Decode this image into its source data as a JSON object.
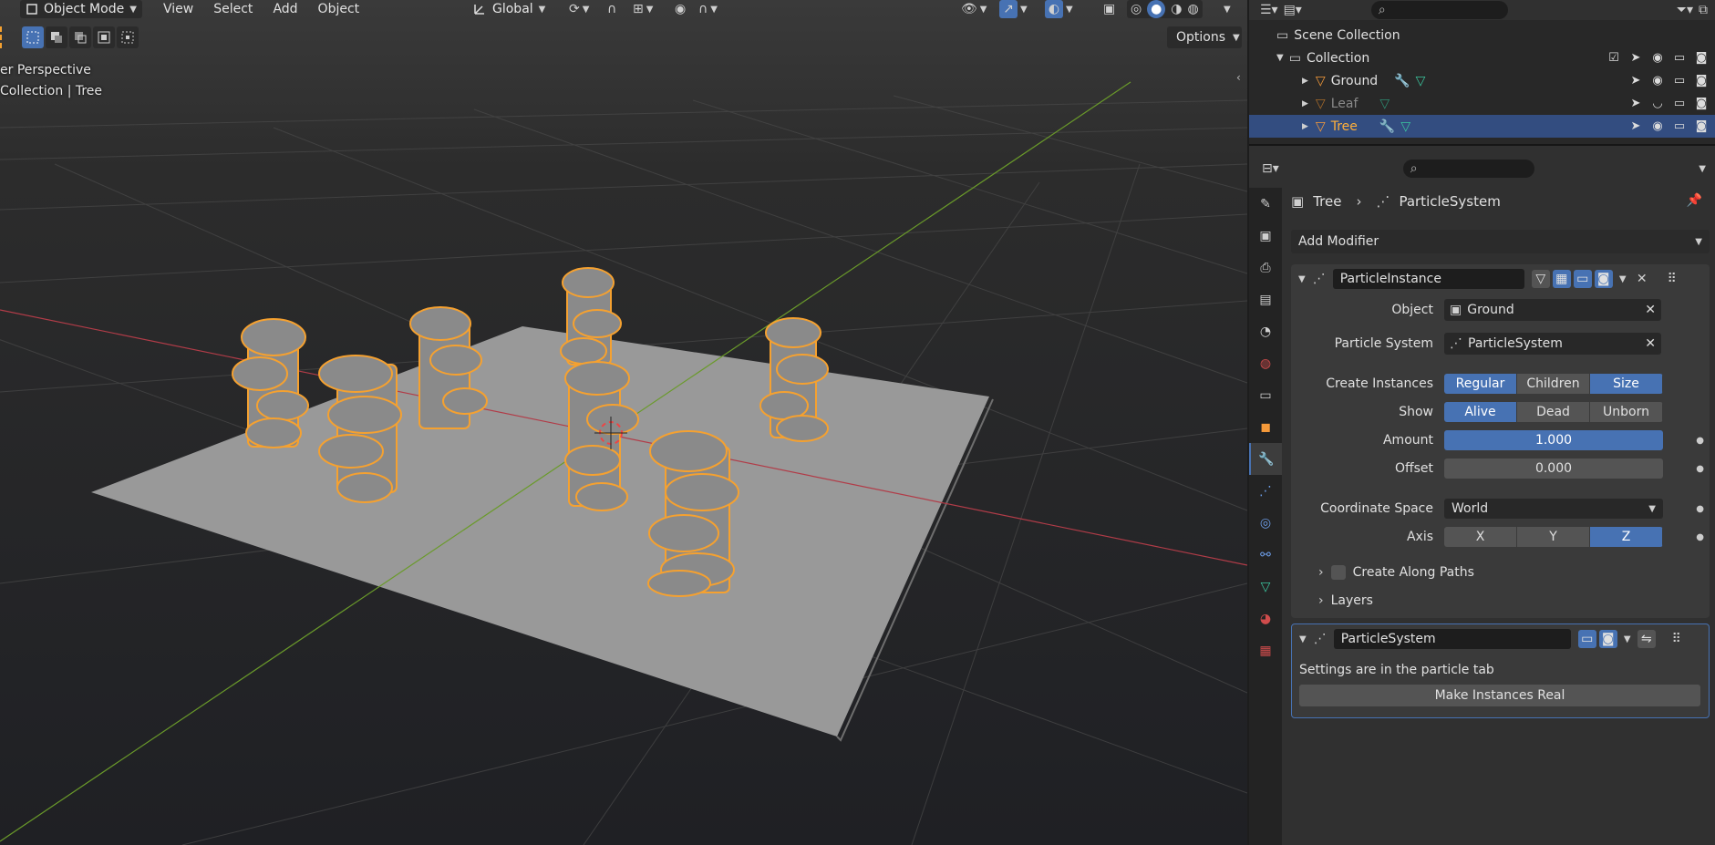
{
  "viewport": {
    "mode_label": "Object Mode",
    "menus": [
      "View",
      "Select",
      "Add",
      "Object"
    ],
    "transform_orientation": "Global",
    "options_label": "Options",
    "overlay_line1": "er Perspective",
    "overlay_line2": "Collection | Tree"
  },
  "outliner": {
    "rows": [
      {
        "label": "Scene Collection"
      },
      {
        "label": "Collection"
      },
      {
        "label": "Ground"
      },
      {
        "label": "Leaf"
      },
      {
        "label": "Tree"
      }
    ]
  },
  "properties": {
    "breadcrumb_object": "Tree",
    "breadcrumb_data": "ParticleSystem",
    "add_modifier_label": "Add Modifier",
    "particle_instance": {
      "name": "ParticleInstance",
      "object_label": "Object",
      "object_value": "Ground",
      "psys_label": "Particle System",
      "psys_value": "ParticleSystem",
      "create_label": "Create Instances",
      "create_options": [
        "Regular",
        "Children",
        "Size"
      ],
      "show_label": "Show",
      "show_options": [
        "Alive",
        "Dead",
        "Unborn"
      ],
      "amount_label": "Amount",
      "amount_value": "1.000",
      "offset_label": "Offset",
      "offset_value": "0.000",
      "coord_label": "Coordinate Space",
      "coord_value": "World",
      "axis_label": "Axis",
      "axis_options": [
        "X",
        "Y",
        "Z"
      ],
      "along_paths_label": "Create Along Paths",
      "layers_label": "Layers"
    },
    "particle_system": {
      "name": "ParticleSystem",
      "info": "Settings are in the particle tab",
      "make_real_label": "Make Instances Real"
    }
  },
  "colors": {
    "accent": "#4772b3",
    "selection_orange": "#f5a130",
    "x_axis": "#b13c48",
    "y_axis": "#6a9a2a"
  }
}
